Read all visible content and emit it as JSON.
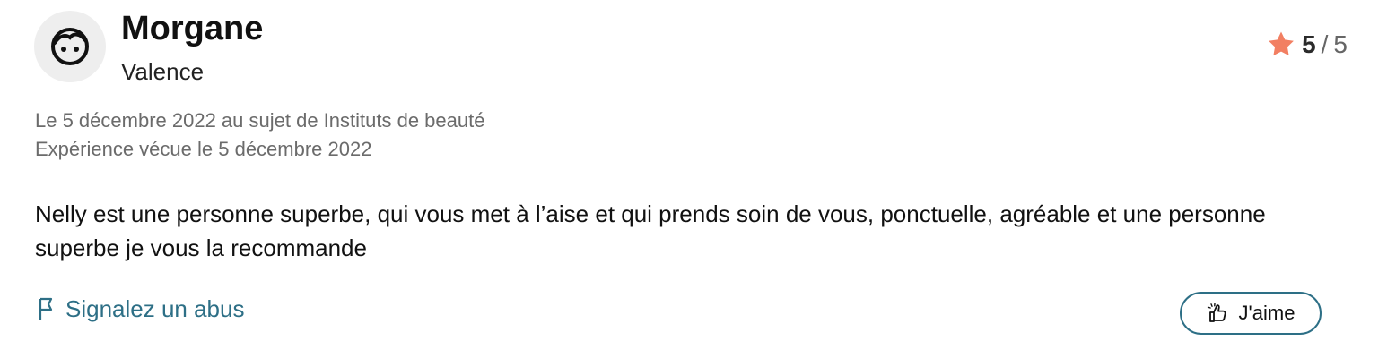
{
  "review": {
    "author": {
      "name": "Morgane",
      "city": "Valence",
      "avatar_icon": "face-icon"
    },
    "rating": {
      "score": "5",
      "separator": "/",
      "max": "5",
      "star_color": "#f27f62"
    },
    "meta": {
      "line1": "Le 5 décembre 2022 au sujet de Instituts de beauté",
      "line2": "Expérience vécue le 5 décembre 2022"
    },
    "text": "Nelly est une personne superbe, qui vous met à l’aise et qui prends soin de vous, ponctuelle, agréable et une personne superbe je vous la recommande",
    "actions": {
      "report_label": "Signalez un abus",
      "report_icon": "flag-icon",
      "like_label": "J'aime",
      "like_icon": "thumbs-up-icon",
      "accent_color": "#2d6f86"
    }
  }
}
